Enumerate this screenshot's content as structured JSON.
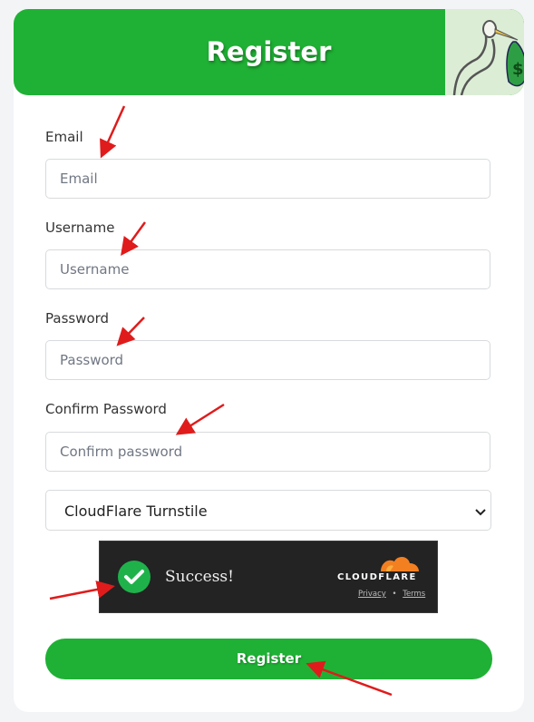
{
  "header": {
    "title": "Register",
    "mascot_icon": "stork-with-money-bag"
  },
  "form": {
    "email": {
      "label": "Email",
      "placeholder": "Email"
    },
    "username": {
      "label": "Username",
      "placeholder": "Username"
    },
    "password": {
      "label": "Password",
      "placeholder": "Password"
    },
    "confirm_password": {
      "label": "Confirm Password",
      "placeholder": "Confirm password"
    },
    "captcha_select": {
      "value": "CloudFlare Turnstile"
    },
    "submit_label": "Register"
  },
  "turnstile": {
    "status": "Success!",
    "brand": "CLOUDFLARE",
    "privacy": "Privacy",
    "separator": "•",
    "terms": "Terms"
  },
  "colors": {
    "accent": "#1fb135",
    "arrow": "#e01b1b",
    "turnstile_bg": "#232323",
    "cloudflare_orange": "#f38020"
  }
}
